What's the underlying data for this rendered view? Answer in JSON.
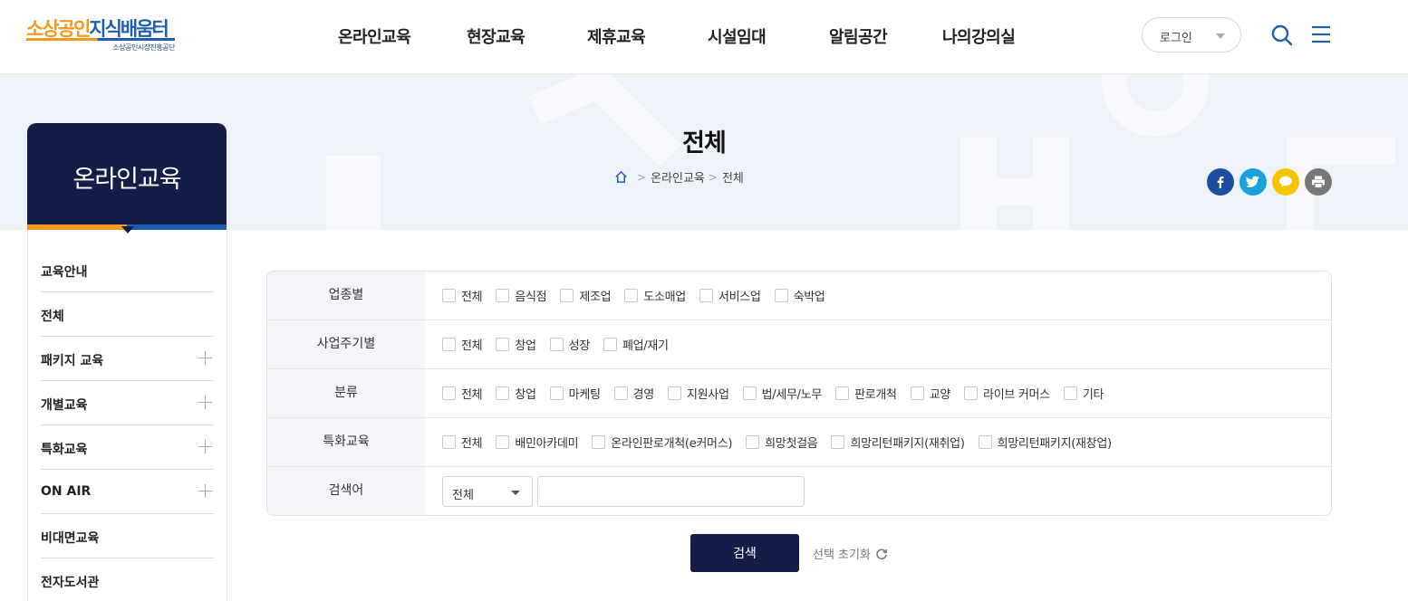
{
  "header": {
    "logo_part1": "소상공인",
    "logo_part2": "지식배움터",
    "logo_sub": "소상공인시장진흥공단",
    "nav": [
      "온라인교육",
      "현장교육",
      "제휴교육",
      "시설임대",
      "알림공간",
      "나의강의실"
    ],
    "login_label": "로그인",
    "search_icon": "search-icon",
    "menu_icon": "hamburger-menu-icon"
  },
  "page": {
    "title": "전체",
    "breadcrumb": [
      "온라인교육",
      "전체"
    ]
  },
  "share": [
    "facebook-icon",
    "twitter-icon",
    "kakaotalk-icon",
    "print-icon"
  ],
  "sidebar": {
    "title": "온라인교육",
    "items": [
      {
        "label": "교육안내",
        "expandable": false
      },
      {
        "label": "전체",
        "expandable": false
      },
      {
        "label": "패키지 교육",
        "expandable": true
      },
      {
        "label": "개별교육",
        "expandable": true
      },
      {
        "label": "특화교육",
        "expandable": true
      },
      {
        "label": "ON AIR",
        "expandable": true
      },
      {
        "label": "비대면교육",
        "expandable": false
      },
      {
        "label": "전자도서관",
        "expandable": false
      }
    ]
  },
  "filters": {
    "industry": {
      "label": "업종별",
      "options": [
        "전체",
        "음식점",
        "제조업",
        "도소매업",
        "서비스업",
        "숙박업"
      ]
    },
    "cycle": {
      "label": "사업주기별",
      "options": [
        "전체",
        "창업",
        "성장",
        "폐업/재기"
      ]
    },
    "category": {
      "label": "분류",
      "options": [
        "전체",
        "창업",
        "마케팅",
        "경영",
        "지원사업",
        "법/세무/노무",
        "판로개척",
        "교양",
        "라이브 커머스",
        "기타"
      ]
    },
    "special": {
      "label": "특화교육",
      "options": [
        "전체",
        "배민아카데미",
        "온라인판로개척(e커머스)",
        "희망첫걸음",
        "희망리턴패키지(재취업)",
        "희망리턴패키지(재창업)"
      ]
    },
    "keyword": {
      "label": "검색어",
      "select_value": "전체",
      "input_value": ""
    }
  },
  "actions": {
    "search_label": "검색",
    "reset_label": "선택 초기화"
  },
  "colors": {
    "navy": "#141d47",
    "orange": "#f29a1f",
    "blue": "#1f5fae",
    "highlight": "#e60000"
  }
}
